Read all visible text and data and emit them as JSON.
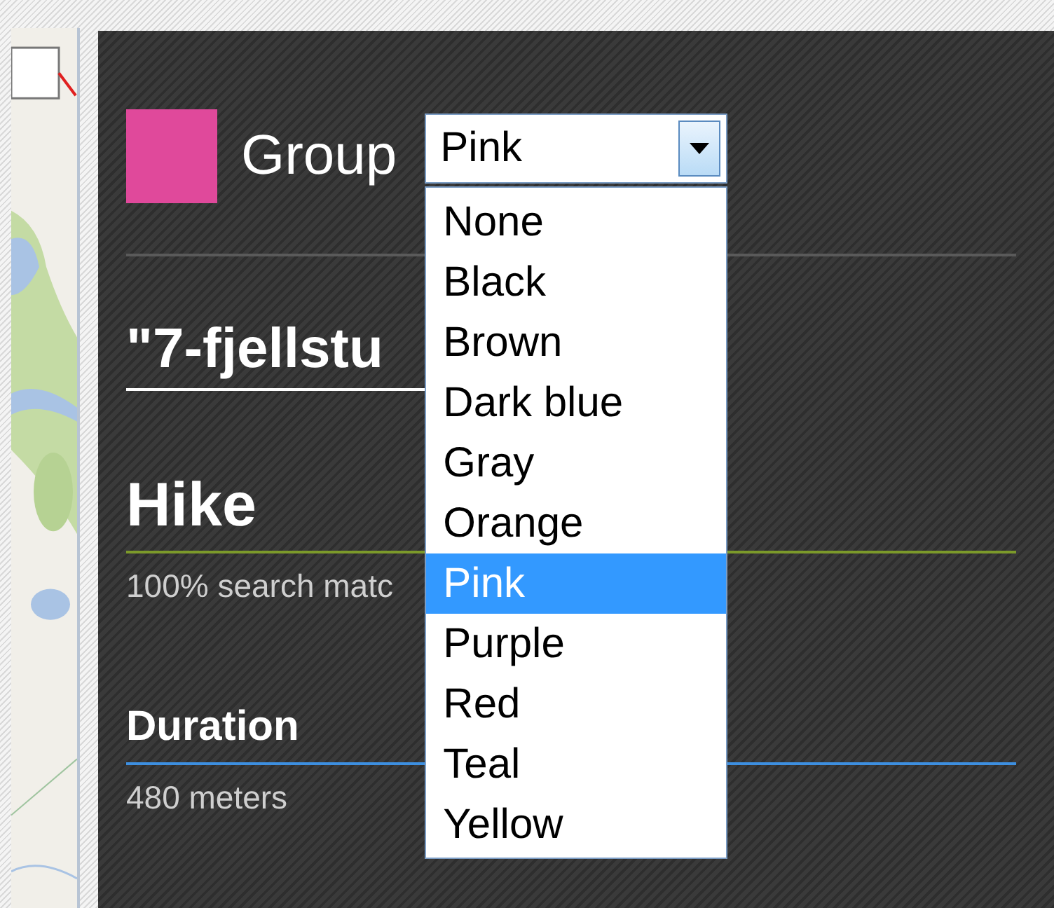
{
  "group": {
    "label": "Group",
    "color": "#e0499b",
    "select": {
      "value": "Pink",
      "expanded": true,
      "options": [
        {
          "label": "None",
          "selected": false
        },
        {
          "label": "Black",
          "selected": false
        },
        {
          "label": "Brown",
          "selected": false
        },
        {
          "label": "Dark blue",
          "selected": false
        },
        {
          "label": "Gray",
          "selected": false
        },
        {
          "label": "Orange",
          "selected": false
        },
        {
          "label": "Pink",
          "selected": true
        },
        {
          "label": "Purple",
          "selected": false
        },
        {
          "label": "Red",
          "selected": false
        },
        {
          "label": "Teal",
          "selected": false
        },
        {
          "label": "Yellow",
          "selected": false
        }
      ]
    }
  },
  "title": "\"7-fjellstu",
  "activity": {
    "name": "Hike",
    "match": "100% search matc"
  },
  "duration": {
    "label": "Duration",
    "value": "480 meters"
  }
}
